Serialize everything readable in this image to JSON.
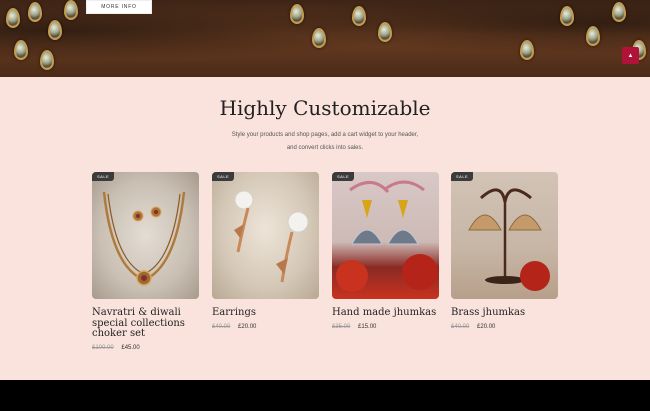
{
  "hero": {
    "more_info_label": "MORE INFO"
  },
  "scroll_top_icon": "chevron-up-icon",
  "section": {
    "title": "Highly Customizable",
    "subtitle_line1": "Style your products and shop pages, add a cart widget to your header,",
    "subtitle_line2": "and convert clicks into sales."
  },
  "products": [
    {
      "badge": "SALE",
      "name": "Navratri & diwali special collections choker set",
      "old_price": "£100.00",
      "price": "£45.00"
    },
    {
      "badge": "SALE",
      "name": "Earrings",
      "old_price": "£40.00",
      "price": "£20.00"
    },
    {
      "badge": "SALE",
      "name": "Hand made jhumkas",
      "old_price": "£35.00",
      "price": "£15.00"
    },
    {
      "badge": "SALE",
      "name": "Brass jhumkas",
      "old_price": "£40.00",
      "price": "£20.00"
    }
  ],
  "colors": {
    "page_bg": "#fae3dc",
    "accent": "#b0123a",
    "badge_bg": "#3b3b3b",
    "footer_bg": "#000000"
  }
}
